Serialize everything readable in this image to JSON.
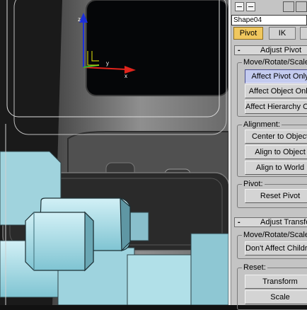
{
  "toolbar": {
    "checkboxes": [
      "checkbox",
      "checkbox"
    ],
    "icons": [
      "display-icon",
      "utilities-icon"
    ]
  },
  "object_name": "Shape04",
  "tabs": [
    {
      "label": "Pivot",
      "active": true
    },
    {
      "label": "IK",
      "active": false
    },
    {
      "label": "",
      "active": false
    }
  ],
  "adjust_pivot": {
    "toggle": "-",
    "title": "Adjust Pivot",
    "move_rotate_scale": {
      "label": "Move/Rotate/Scale:",
      "buttons": [
        "Affect Pivot Only",
        "Affect Object Only",
        "Affect Hierarchy Only"
      ]
    },
    "alignment": {
      "label": "Alignment:",
      "buttons": [
        "Center to Object",
        "Align to Object",
        "Align to World"
      ]
    },
    "pivot": {
      "label": "Pivot:",
      "buttons": [
        "Reset Pivot"
      ]
    }
  },
  "adjust_transform": {
    "toggle": "-",
    "title": "Adjust Transform",
    "move_rotate_scale": {
      "label": "Move/Rotate/Scale:",
      "buttons": [
        "Don't Affect Children"
      ]
    },
    "reset": {
      "label": "Reset:",
      "buttons": [
        "Transform",
        "Scale"
      ]
    }
  },
  "colors": {
    "active_tab": "#f0c75e",
    "active_button": "#c4cbef",
    "panel_bg": "#c4c4c4",
    "axis_x": "#e0241c",
    "axis_y": "#2db32d",
    "axis_z": "#1c2fd9",
    "mesh_cyan": "#a7dbe6",
    "selection_wire": "#d9d9d9"
  }
}
